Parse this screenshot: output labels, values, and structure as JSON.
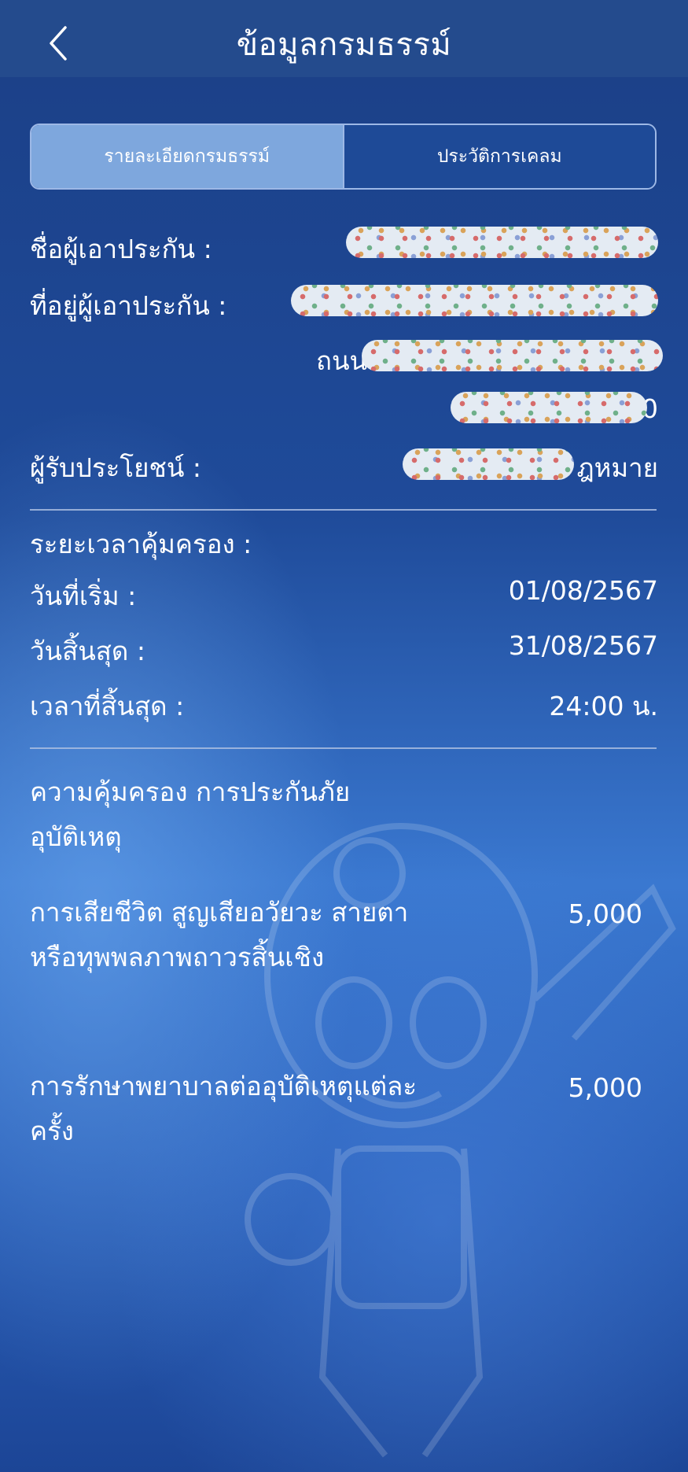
{
  "header": {
    "title": "ข้อมูลกรมธรรม์",
    "back_icon": "chevron-left-icon"
  },
  "tabs": [
    {
      "label": "รายละเอียดกรมธรรม์",
      "active": true
    },
    {
      "label": "ประวัติการเคลม",
      "active": false
    }
  ],
  "insured": {
    "name_label": "ชื่อผู้เอาประกัน :",
    "address_label": "ที่อยู่ผู้เอาประกัน :",
    "address_line2_prefix": "ถนน",
    "address_line3_suffix": "0",
    "beneficiary_label": "ผู้รับประโยชน์ :",
    "beneficiary_suffix": "ฎหมาย"
  },
  "period": {
    "heading": "ระยะเวลาคุ้มครอง :",
    "start_label": "วันที่เริ่ม :",
    "start_value": "01/08/2567",
    "end_label": "วันสิ้นสุด :",
    "end_value": "31/08/2567",
    "end_time_label": "เวลาที่สิ้นสุด :",
    "end_time_value": "24:00 น."
  },
  "coverage": {
    "heading": "ความคุ้มครอง การประกันภัยอุบัติเหตุ",
    "items": [
      {
        "label": "การเสียชีวิต สูญเสียอวัยวะ สายตา หรือทุพพลภาพถาวรสิ้นเชิง",
        "value": "5,000"
      },
      {
        "label": "การรักษาพยาบาลต่ออุบัติเหตุแต่ละครั้ง",
        "value": "5,000"
      }
    ]
  },
  "colors": {
    "header_bg": "#244b8d",
    "tab_active_bg": "#7ea7dd",
    "tab_inactive_bg": "#1e4a97",
    "divider": "#a9bde0"
  }
}
